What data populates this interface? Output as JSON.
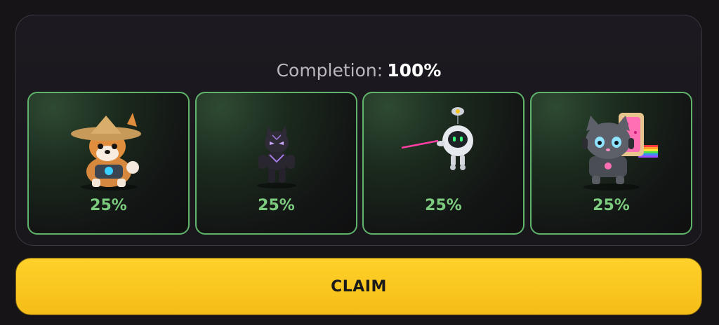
{
  "completion": {
    "label": "Completion:",
    "value": "100%"
  },
  "cards": [
    {
      "icon": "shiba-dog-icon",
      "percent": "25%"
    },
    {
      "icon": "black-panther-icon",
      "percent": "25%"
    },
    {
      "icon": "robot-drone-icon",
      "percent": "25%"
    },
    {
      "icon": "nyan-cat-icon",
      "percent": "25%"
    }
  ],
  "claim": {
    "label": "CLAIM"
  },
  "colors": {
    "accent_green": "#7ccb7e",
    "card_border": "#5fb36a",
    "claim_yellow": "#f9c41c"
  }
}
